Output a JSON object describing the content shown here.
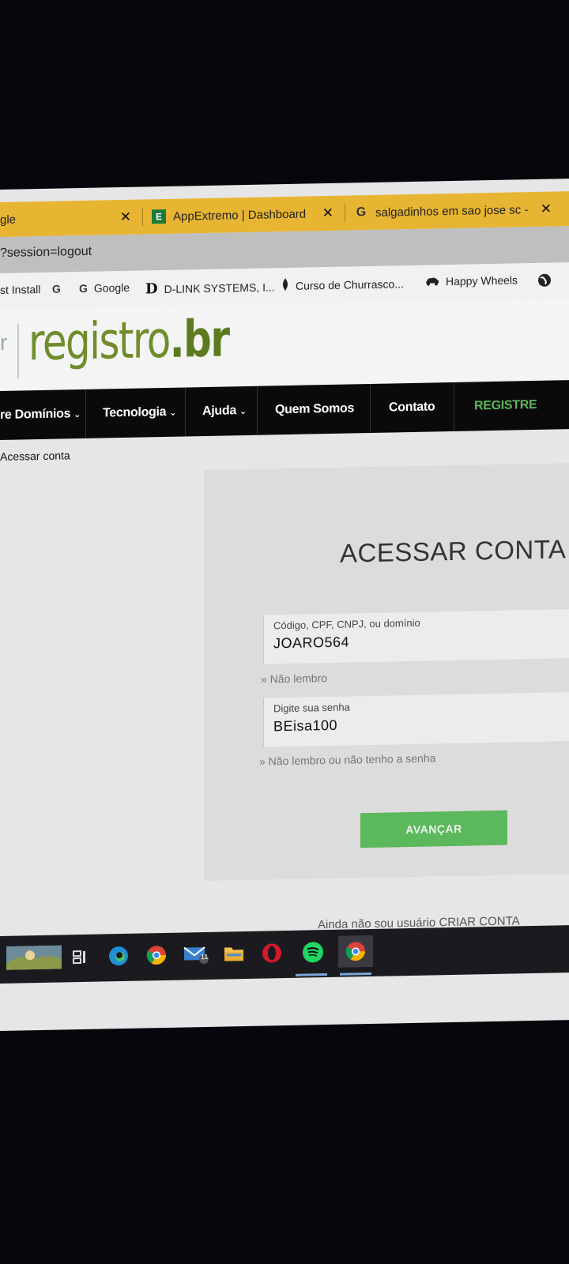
{
  "tabs": [
    {
      "label": "gle",
      "close": "✕"
    },
    {
      "favicon": "E",
      "label": "AppExtremo | Dashboard",
      "close": "✕"
    },
    {
      "favicon": "G",
      "label": "salgadinhos em sao jose sc -",
      "close": "✕"
    }
  ],
  "address": {
    "url": "?session=logout"
  },
  "bookmarks": [
    {
      "icon": "",
      "label": "st Install"
    },
    {
      "icon": "G",
      "label": ""
    },
    {
      "icon": "G",
      "label": "Google"
    },
    {
      "icon": "D",
      "label": "D-LINK SYSTEMS, I..."
    },
    {
      "icon": "flame-icon",
      "label": "Curso de Churrasco..."
    },
    {
      "icon": "car-icon",
      "label": "Happy Wheels"
    },
    {
      "icon": "globe-icon",
      "label": ""
    }
  ],
  "logo": {
    "frag": "r",
    "main": "registro",
    "suffix": ".br"
  },
  "nav": {
    "items": [
      {
        "label": "re Domínios",
        "chevron": "⌄"
      },
      {
        "label": "Tecnologia",
        "chevron": "⌄"
      },
      {
        "label": "Ajuda",
        "chevron": "⌄"
      },
      {
        "label": "Quem Somos"
      },
      {
        "label": "Contato"
      },
      {
        "label": "REGISTRE"
      }
    ]
  },
  "breadcrumb": "Acessar conta",
  "login": {
    "title": "ACESSAR CONTA",
    "user_label": "Código, CPF, CNPJ, ou domínio",
    "user_value": "JOARO564",
    "user_help": "» Não lembro",
    "pass_label": "Digite sua senha",
    "pass_value": "BEisa100",
    "pass_help": "» Não lembro ou não tenho a senha",
    "submit": "AVANÇAR",
    "signup_text": "Ainda não sou usuário",
    "signup_link": "CRIAR CONTA"
  },
  "taskbar": {
    "icons": [
      "weather-icon",
      "task-view-icon",
      "edge-icon",
      "chrome-icon",
      "mail-icon",
      "folder-icon",
      "opera-icon",
      "spotify-icon",
      "chrome-active-icon"
    ],
    "mail_badge": "11"
  },
  "colors": {
    "tabbar": "#e8b532",
    "brand_green": "#6f8d2b",
    "button_green": "#5cb85c",
    "nav_bg": "#0a0a0a"
  }
}
